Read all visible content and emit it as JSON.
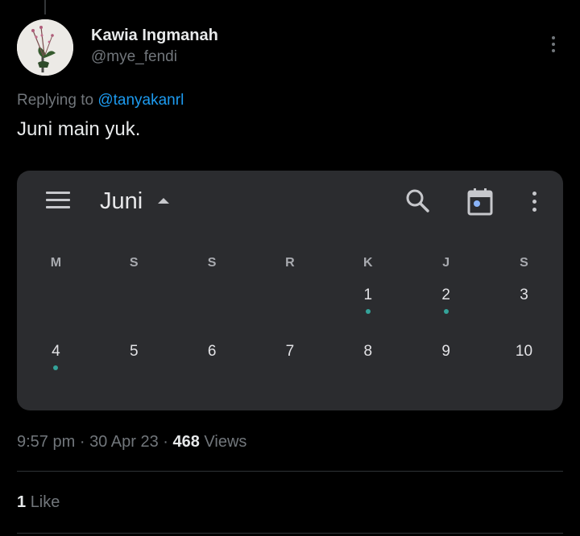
{
  "tweet": {
    "author_name": "Kawia Ingmanah",
    "author_handle": "@mye_fendi",
    "replying_prefix": "Replying to",
    "replying_to": "@tanyakanrl",
    "text": "Juni main yuk.",
    "time": "9:57 pm",
    "date": "30 Apr 23",
    "views_count": "468",
    "views_label": "Views",
    "separator": "·",
    "likes_count": "1",
    "likes_label": "Like"
  },
  "calendar": {
    "month": "Juni",
    "weekdays": [
      "M",
      "S",
      "S",
      "R",
      "K",
      "J",
      "S"
    ],
    "weeks": [
      [
        {
          "day": "",
          "event": false
        },
        {
          "day": "",
          "event": false
        },
        {
          "day": "",
          "event": false
        },
        {
          "day": "",
          "event": false
        },
        {
          "day": "1",
          "event": true
        },
        {
          "day": "2",
          "event": true
        },
        {
          "day": "3",
          "event": false
        }
      ],
      [
        {
          "day": "4",
          "event": true
        },
        {
          "day": "5",
          "event": false
        },
        {
          "day": "6",
          "event": false
        },
        {
          "day": "7",
          "event": false
        },
        {
          "day": "8",
          "event": false
        },
        {
          "day": "9",
          "event": false
        },
        {
          "day": "10",
          "event": false
        }
      ]
    ]
  },
  "icons": {
    "more": "more-vertical-icon",
    "menu": "hamburger-menu-icon",
    "caret": "caret-up-icon",
    "search": "search-icon",
    "today": "calendar-today-icon",
    "cal_more": "more-vertical-icon"
  },
  "colors": {
    "background": "#000000",
    "link": "#1d9bf0",
    "muted": "#71767b",
    "card": "#2b2c2f",
    "event_dot": "#34a39a",
    "today_icon_dot": "#8ab4f8"
  }
}
